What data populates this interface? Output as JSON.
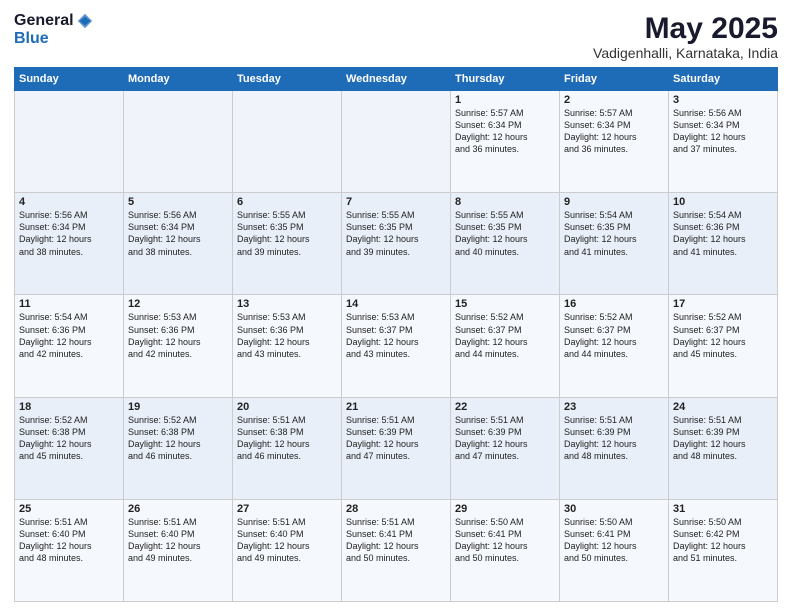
{
  "header": {
    "logo_general": "General",
    "logo_blue": "Blue",
    "month_year": "May 2025",
    "location": "Vadigenhalli, Karnataka, India"
  },
  "days_of_week": [
    "Sunday",
    "Monday",
    "Tuesday",
    "Wednesday",
    "Thursday",
    "Friday",
    "Saturday"
  ],
  "weeks": [
    [
      {
        "day": "",
        "content": ""
      },
      {
        "day": "",
        "content": ""
      },
      {
        "day": "",
        "content": ""
      },
      {
        "day": "",
        "content": ""
      },
      {
        "day": "1",
        "content": "Sunrise: 5:57 AM\nSunset: 6:34 PM\nDaylight: 12 hours\nand 36 minutes."
      },
      {
        "day": "2",
        "content": "Sunrise: 5:57 AM\nSunset: 6:34 PM\nDaylight: 12 hours\nand 36 minutes."
      },
      {
        "day": "3",
        "content": "Sunrise: 5:56 AM\nSunset: 6:34 PM\nDaylight: 12 hours\nand 37 minutes."
      }
    ],
    [
      {
        "day": "4",
        "content": "Sunrise: 5:56 AM\nSunset: 6:34 PM\nDaylight: 12 hours\nand 38 minutes."
      },
      {
        "day": "5",
        "content": "Sunrise: 5:56 AM\nSunset: 6:34 PM\nDaylight: 12 hours\nand 38 minutes."
      },
      {
        "day": "6",
        "content": "Sunrise: 5:55 AM\nSunset: 6:35 PM\nDaylight: 12 hours\nand 39 minutes."
      },
      {
        "day": "7",
        "content": "Sunrise: 5:55 AM\nSunset: 6:35 PM\nDaylight: 12 hours\nand 39 minutes."
      },
      {
        "day": "8",
        "content": "Sunrise: 5:55 AM\nSunset: 6:35 PM\nDaylight: 12 hours\nand 40 minutes."
      },
      {
        "day": "9",
        "content": "Sunrise: 5:54 AM\nSunset: 6:35 PM\nDaylight: 12 hours\nand 41 minutes."
      },
      {
        "day": "10",
        "content": "Sunrise: 5:54 AM\nSunset: 6:36 PM\nDaylight: 12 hours\nand 41 minutes."
      }
    ],
    [
      {
        "day": "11",
        "content": "Sunrise: 5:54 AM\nSunset: 6:36 PM\nDaylight: 12 hours\nand 42 minutes."
      },
      {
        "day": "12",
        "content": "Sunrise: 5:53 AM\nSunset: 6:36 PM\nDaylight: 12 hours\nand 42 minutes."
      },
      {
        "day": "13",
        "content": "Sunrise: 5:53 AM\nSunset: 6:36 PM\nDaylight: 12 hours\nand 43 minutes."
      },
      {
        "day": "14",
        "content": "Sunrise: 5:53 AM\nSunset: 6:37 PM\nDaylight: 12 hours\nand 43 minutes."
      },
      {
        "day": "15",
        "content": "Sunrise: 5:52 AM\nSunset: 6:37 PM\nDaylight: 12 hours\nand 44 minutes."
      },
      {
        "day": "16",
        "content": "Sunrise: 5:52 AM\nSunset: 6:37 PM\nDaylight: 12 hours\nand 44 minutes."
      },
      {
        "day": "17",
        "content": "Sunrise: 5:52 AM\nSunset: 6:37 PM\nDaylight: 12 hours\nand 45 minutes."
      }
    ],
    [
      {
        "day": "18",
        "content": "Sunrise: 5:52 AM\nSunset: 6:38 PM\nDaylight: 12 hours\nand 45 minutes."
      },
      {
        "day": "19",
        "content": "Sunrise: 5:52 AM\nSunset: 6:38 PM\nDaylight: 12 hours\nand 46 minutes."
      },
      {
        "day": "20",
        "content": "Sunrise: 5:51 AM\nSunset: 6:38 PM\nDaylight: 12 hours\nand 46 minutes."
      },
      {
        "day": "21",
        "content": "Sunrise: 5:51 AM\nSunset: 6:39 PM\nDaylight: 12 hours\nand 47 minutes."
      },
      {
        "day": "22",
        "content": "Sunrise: 5:51 AM\nSunset: 6:39 PM\nDaylight: 12 hours\nand 47 minutes."
      },
      {
        "day": "23",
        "content": "Sunrise: 5:51 AM\nSunset: 6:39 PM\nDaylight: 12 hours\nand 48 minutes."
      },
      {
        "day": "24",
        "content": "Sunrise: 5:51 AM\nSunset: 6:39 PM\nDaylight: 12 hours\nand 48 minutes."
      }
    ],
    [
      {
        "day": "25",
        "content": "Sunrise: 5:51 AM\nSunset: 6:40 PM\nDaylight: 12 hours\nand 48 minutes."
      },
      {
        "day": "26",
        "content": "Sunrise: 5:51 AM\nSunset: 6:40 PM\nDaylight: 12 hours\nand 49 minutes."
      },
      {
        "day": "27",
        "content": "Sunrise: 5:51 AM\nSunset: 6:40 PM\nDaylight: 12 hours\nand 49 minutes."
      },
      {
        "day": "28",
        "content": "Sunrise: 5:51 AM\nSunset: 6:41 PM\nDaylight: 12 hours\nand 50 minutes."
      },
      {
        "day": "29",
        "content": "Sunrise: 5:50 AM\nSunset: 6:41 PM\nDaylight: 12 hours\nand 50 minutes."
      },
      {
        "day": "30",
        "content": "Sunrise: 5:50 AM\nSunset: 6:41 PM\nDaylight: 12 hours\nand 50 minutes."
      },
      {
        "day": "31",
        "content": "Sunrise: 5:50 AM\nSunset: 6:42 PM\nDaylight: 12 hours\nand 51 minutes."
      }
    ]
  ]
}
